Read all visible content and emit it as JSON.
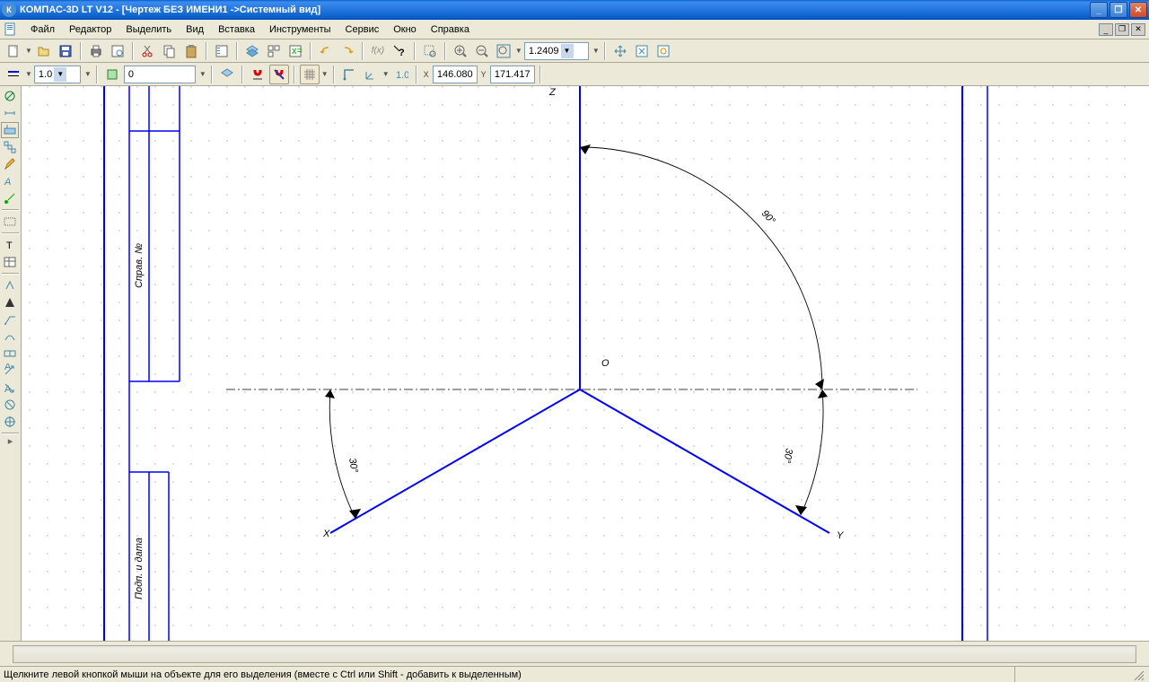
{
  "title": "КОМПАС-3D LT V12 - [Чертеж БЕЗ ИМЕНИ1 ->Системный вид]",
  "menu": {
    "file": "Файл",
    "editor": "Редактор",
    "select": "Выделить",
    "view": "Вид",
    "insert": "Вставка",
    "tools": "Инструменты",
    "service": "Сервис",
    "window": "Окно",
    "help": "Справка"
  },
  "toolbar2": {
    "viewNumber": "0",
    "zoom": "1.2409",
    "scale": "1.0",
    "x_value": "146.080",
    "y_value": "171.417",
    "x_label": "X",
    "y_label": "Y"
  },
  "canvas": {
    "origin_label": "О",
    "z_label": "Z",
    "x_label": "X",
    "y_label": "Y",
    "angle90": "90°",
    "angle30_left": "30°",
    "angle30_right": "30°",
    "frame_text1": "Справ. №",
    "frame_text2": "Подп. и дата"
  },
  "status": "Щелкните левой кнопкой мыши на объекте для его выделения (вместе с Ctrl или Shift - добавить к выделенным)"
}
